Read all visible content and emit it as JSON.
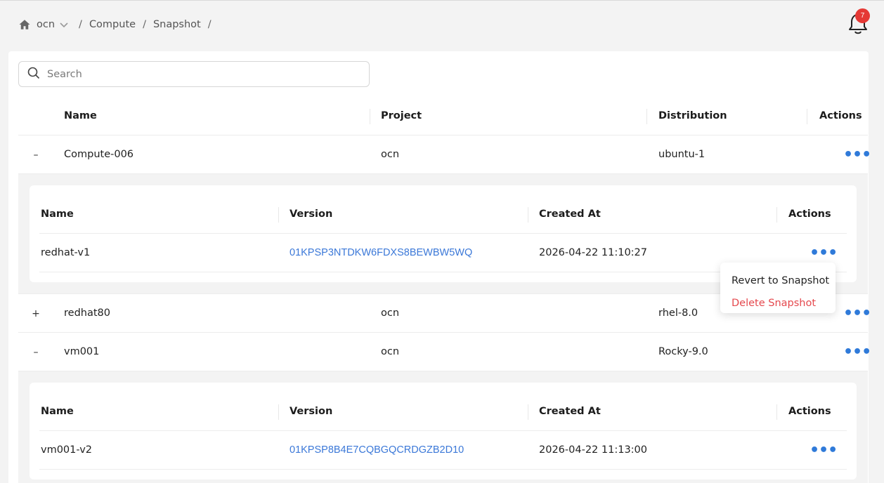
{
  "breadcrumb": {
    "project": "ocn",
    "items": [
      "Compute",
      "Snapshot"
    ],
    "separator": "/"
  },
  "notifications": {
    "count": "7"
  },
  "search": {
    "placeholder": "Search"
  },
  "table": {
    "headers": [
      "Name",
      "Project",
      "Distribution",
      "Actions"
    ],
    "rows": [
      {
        "expanded": true,
        "toggle": "–",
        "name": "Compute-006",
        "project": "ocn",
        "distribution": "ubuntu-1",
        "snapshots": {
          "headers": [
            "Name",
            "Version",
            "Created At",
            "Actions"
          ],
          "rows": [
            {
              "name": "redhat-v1",
              "version": "01KPSP3NTDKW6FDXS8BEWBW5WQ",
              "created_at": "2026-04-22 11:10:27"
            }
          ]
        }
      },
      {
        "expanded": false,
        "toggle": "+",
        "name": "redhat80",
        "project": "ocn",
        "distribution": "rhel-8.0"
      },
      {
        "expanded": true,
        "toggle": "–",
        "name": "vm001",
        "project": "ocn",
        "distribution": "Rocky-9.0",
        "snapshots": {
          "headers": [
            "Name",
            "Version",
            "Created At",
            "Actions"
          ],
          "rows": [
            {
              "name": "vm001-v2",
              "version": "01KPSP8B4E7CQBGQCRDGZB2D10",
              "created_at": "2026-04-22 11:13:00"
            }
          ]
        }
      }
    ]
  },
  "actions_icon": "•••",
  "context_menu": {
    "items": [
      "Revert to Snapshot",
      "Delete Snapshot"
    ]
  },
  "colors": {
    "link": "#3b78d8",
    "danger": "#e5484d",
    "badge": "#e53935"
  }
}
